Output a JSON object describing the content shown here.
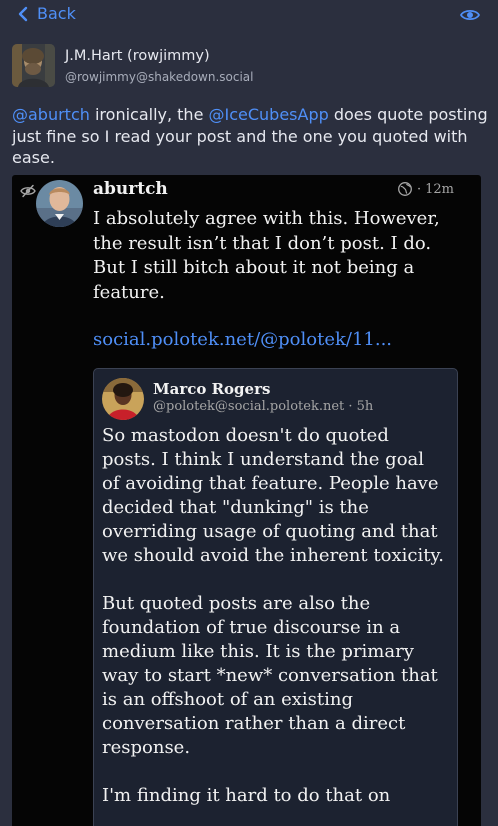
{
  "nav": {
    "back_label": "Back"
  },
  "author": {
    "display_name": "J.M.Hart (rowjimmy)",
    "handle": "@rowjimmy@shakedown.social"
  },
  "post": {
    "mention1": "@aburtch",
    "text1": " ironically, the ",
    "mention2": "@IceCubesApp",
    "text2": " does quote posting just fine so I read your post and the one you quoted with ease."
  },
  "quoted": {
    "name": "aburtch",
    "time": "12m",
    "dot": "·",
    "text": "I absolutely agree with this. However, the result isn’t that I don’t post. I do. But I still bitch about it not being a feature.",
    "link": "social.polotek.net/@polotek/11..."
  },
  "nested": {
    "name": "Marco Rogers",
    "handle": "@polotek@social.polotek.net · 5h",
    "paragraphs": [
      "So mastodon doesn't do quoted posts. I think I understand the goal of avoiding that feature. People have decided that \"dunking\" is the overriding usage of quoting and that we should avoid the inherent toxicity.",
      "But quoted posts are also the foundation of true discourse in a medium like this. It is the primary way to start *new* conversation that is an offshoot of an existing conversation rather than a direct response.",
      "I'm finding it hard to do that on"
    ]
  },
  "icons": {
    "back": "chevron-left-icon",
    "visibility": "eye-icon",
    "hidden": "eye-slash-icon",
    "globe": "globe-icon"
  },
  "colors": {
    "accent": "#4f8ff7",
    "background": "#2b2f3e",
    "card": "#050505",
    "nested_card": "#1c2230"
  }
}
